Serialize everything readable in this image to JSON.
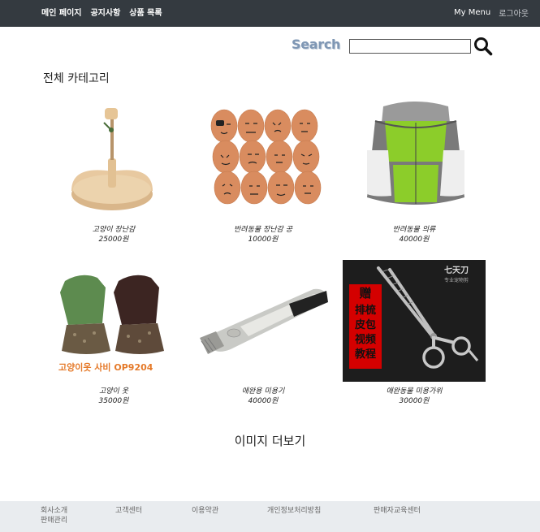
{
  "topbar": {
    "left_links": [
      "메인 페이지",
      "공지사항",
      "상품 목록"
    ],
    "my_menu": "My Menu",
    "logout": "로그아웃"
  },
  "search": {
    "label": "Search",
    "value": "",
    "placeholder": ""
  },
  "section_title": "전체 카테고리",
  "products": [
    {
      "name": "고양이 장난감",
      "price": "25000원",
      "image": "cat-toy-wooden-stand"
    },
    {
      "name": "반려동물 장난감 공",
      "price": "10000원",
      "image": "egg-face-balls"
    },
    {
      "name": "반려동물 의류",
      "price": "40000원",
      "image": "green-grey-pet-jacket"
    },
    {
      "name": "고양이 옷",
      "price": "35000원",
      "image": "cat-clothes-green-brown",
      "image_caption": "고양이옷 사비 OP9204"
    },
    {
      "name": "애완용 미용기",
      "price": "40000원",
      "image": "pet-hair-clipper"
    },
    {
      "name": "애완동물 미용가위",
      "price": "30000원",
      "image": "grooming-scissors",
      "image_caption_vertical": [
        "赠",
        "排梳",
        "皮包",
        "视频",
        "教程"
      ],
      "image_logo": "七天刀",
      "image_logo_sub": "专业宠物剪"
    }
  ],
  "more_link": "이미지 더보기",
  "footer": {
    "links": [
      "회사소개",
      "고객센터",
      "이용약관",
      "개인정보처리방침",
      "판매자교육센터"
    ],
    "second_row": "판매관리"
  },
  "colors": {
    "topbar_bg": "#343a40",
    "footer_bg": "#e9ecef",
    "search_label": "#7f97b4"
  }
}
